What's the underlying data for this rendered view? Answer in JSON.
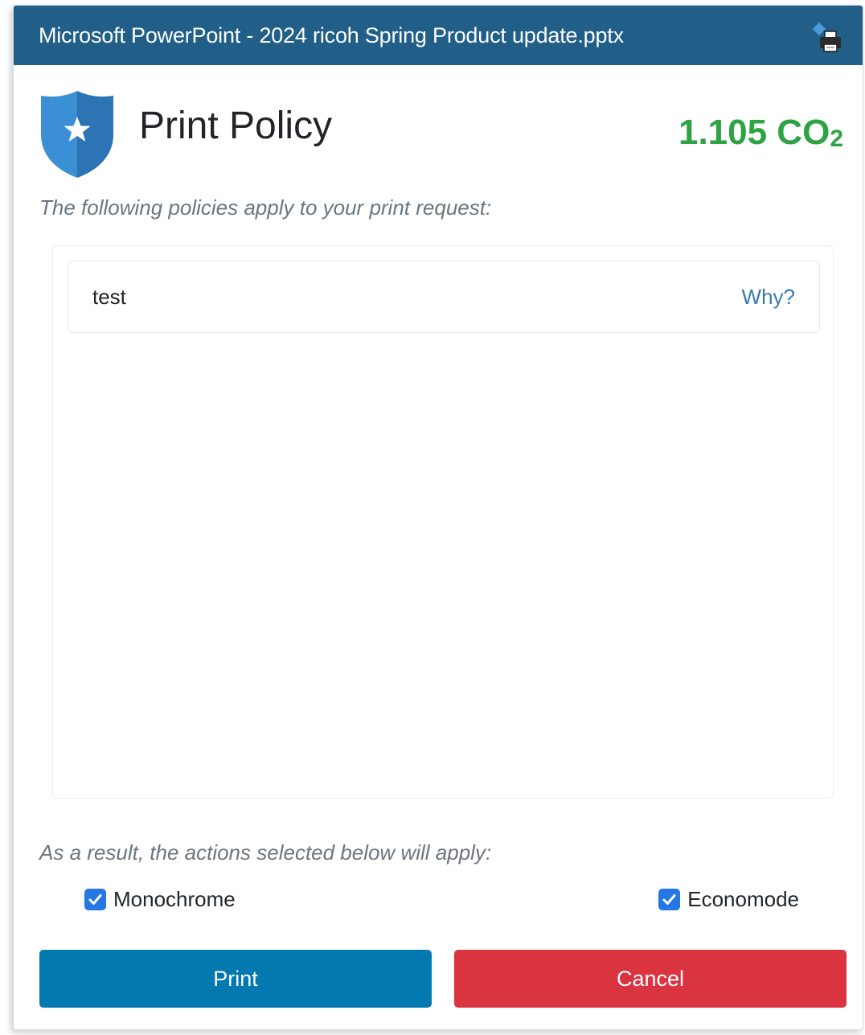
{
  "window": {
    "title": "Microsoft PowerPoint - 2024 ricoh Spring Product update.pptx",
    "title_icon": "printer-settings-icon"
  },
  "header": {
    "icon": "shield-star-icon",
    "title": "Print Policy",
    "co2_value": "1.105 CO",
    "co2_subscript": "2"
  },
  "policies": {
    "intro": "The following policies apply to your print request:",
    "items": [
      {
        "name": "test",
        "link": "Why?"
      }
    ]
  },
  "actions": {
    "intro": "As a result, the actions selected below will apply:",
    "options": [
      {
        "label": "Monochrome",
        "checked": true
      },
      {
        "label": "Economode",
        "checked": true
      }
    ]
  },
  "buttons": {
    "print": "Print",
    "cancel": "Cancel"
  },
  "colors": {
    "titlebar": "#215f89",
    "co2": "#2ea344",
    "print_button": "#0479b0",
    "cancel_button": "#da3441",
    "checkbox": "#2578e4",
    "link": "#3a78b3"
  }
}
